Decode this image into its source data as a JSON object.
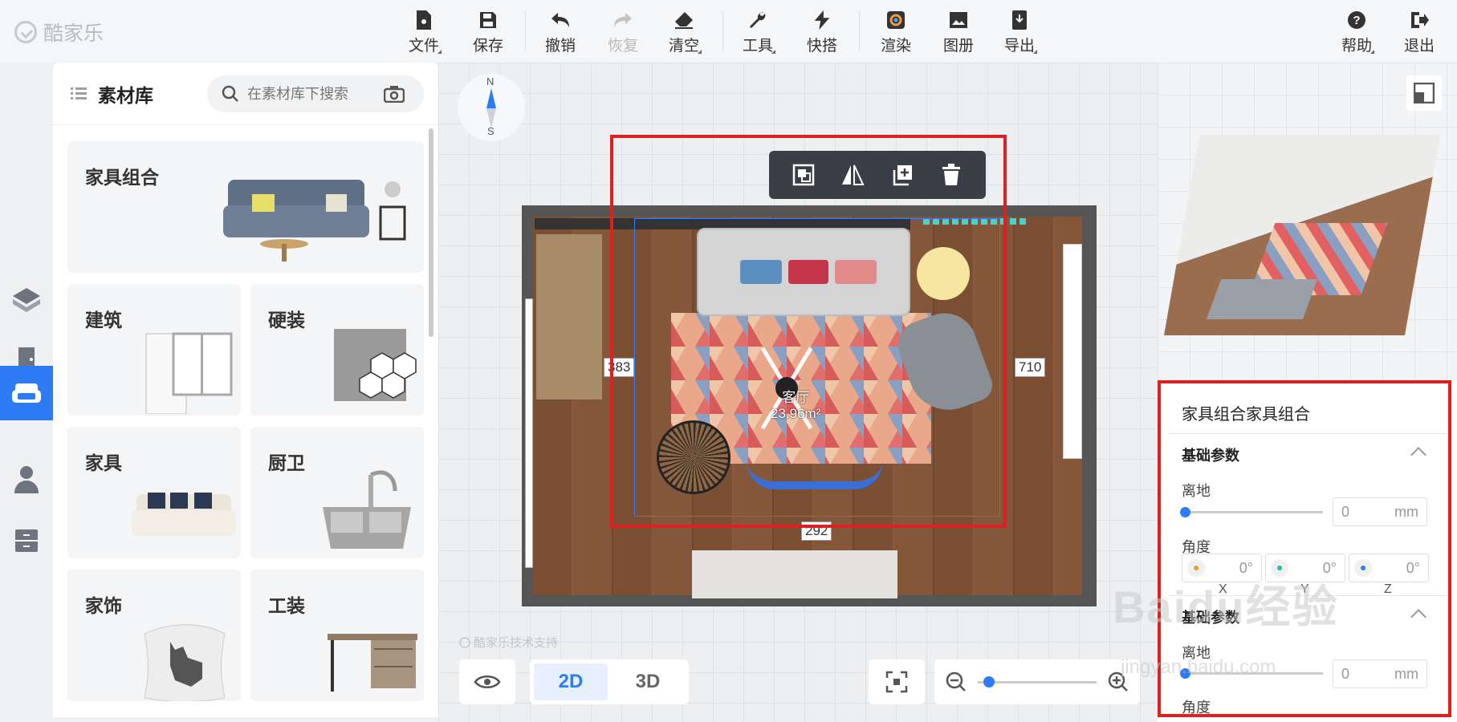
{
  "app": {
    "logo_text": "酷家乐"
  },
  "toolbar": {
    "file": "文件",
    "save": "保存",
    "undo": "撤销",
    "redo": "恢复",
    "clear": "清空",
    "tools": "工具",
    "quick": "快搭",
    "render": "渲染",
    "album": "图册",
    "export": "导出",
    "help": "帮助",
    "exit": "退出"
  },
  "library": {
    "title": "素材库",
    "search_placeholder": "在素材库下搜索",
    "cards": [
      {
        "label": "家具组合"
      },
      {
        "label": "建筑"
      },
      {
        "label": "硬装"
      },
      {
        "label": "家具"
      },
      {
        "label": "厨卫"
      },
      {
        "label": "家饰"
      },
      {
        "label": "工装"
      }
    ]
  },
  "compass": {
    "north": "N",
    "south": "S"
  },
  "plan": {
    "room_name": "客厅",
    "room_area": "23.96m²",
    "dim_left": "383",
    "dim_right": "710",
    "dim_bottom": "292"
  },
  "support_text": "酷家乐技术支持",
  "view": {
    "mode_2d": "2D",
    "mode_3d": "3D",
    "active": "2D",
    "zoom_level": 0.05
  },
  "properties": {
    "title": "家具组合家具组合",
    "section1": "基础参数",
    "height_label": "离地",
    "height_value": "0",
    "height_unit": "mm",
    "angle_label": "角度",
    "angle_x": "0°",
    "angle_y": "0°",
    "angle_z": "0°",
    "axis_x": "X",
    "axis_y": "Y",
    "axis_z": "Z",
    "section2": "基础参数",
    "height_label2": "离地",
    "height_value2": "0",
    "height_unit2": "mm",
    "angle_label2": "角度",
    "axis_colors": {
      "x": "#f0a020",
      "y": "#20c0a0",
      "z": "#2d7cf6"
    }
  },
  "watermark": {
    "brand": "Baidu经验",
    "url": "jingyan.baidu.com"
  },
  "colors": {
    "accent": "#2d7cf6",
    "highlight": "#e02020"
  }
}
